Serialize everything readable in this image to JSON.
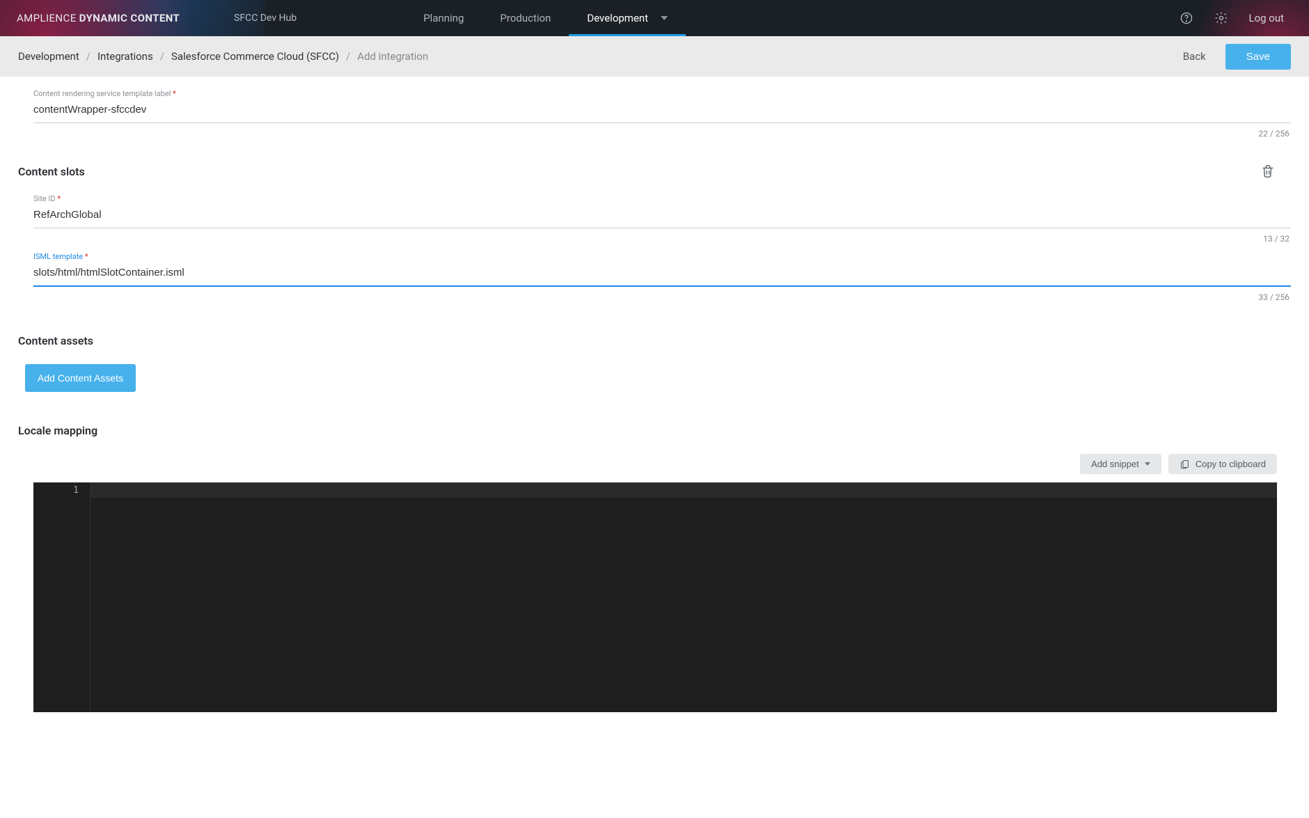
{
  "brand": {
    "light": "AMPLIENCE",
    "bold": "DYNAMIC CONTENT"
  },
  "hub": "SFCC Dev Hub",
  "nav": {
    "planning": "Planning",
    "production": "Production",
    "development": "Development"
  },
  "logout": "Log out",
  "breadcrumbs": {
    "a": "Development",
    "b": "Integrations",
    "c": "Salesforce Commerce Cloud (SFCC)",
    "d": "Add integration"
  },
  "actions": {
    "back": "Back",
    "save": "Save"
  },
  "fields": {
    "crs": {
      "label": "Content rendering service template label",
      "value": "contentWrapper-sfccdev",
      "counter": "22 / 256"
    },
    "siteid": {
      "label": "Site ID",
      "value": "RefArchGlobal",
      "counter": "13 / 32"
    },
    "isml": {
      "label": "ISML template",
      "value": "slots/html/htmlSlotContainer.isml",
      "counter": "33 / 256"
    }
  },
  "sections": {
    "slots": "Content slots",
    "assets": "Content assets",
    "locale": "Locale mapping"
  },
  "buttons": {
    "addAssets": "Add Content Assets",
    "addSnippet": "Add snippet",
    "copy": "Copy to clipboard"
  },
  "editor": {
    "line1": "1"
  }
}
